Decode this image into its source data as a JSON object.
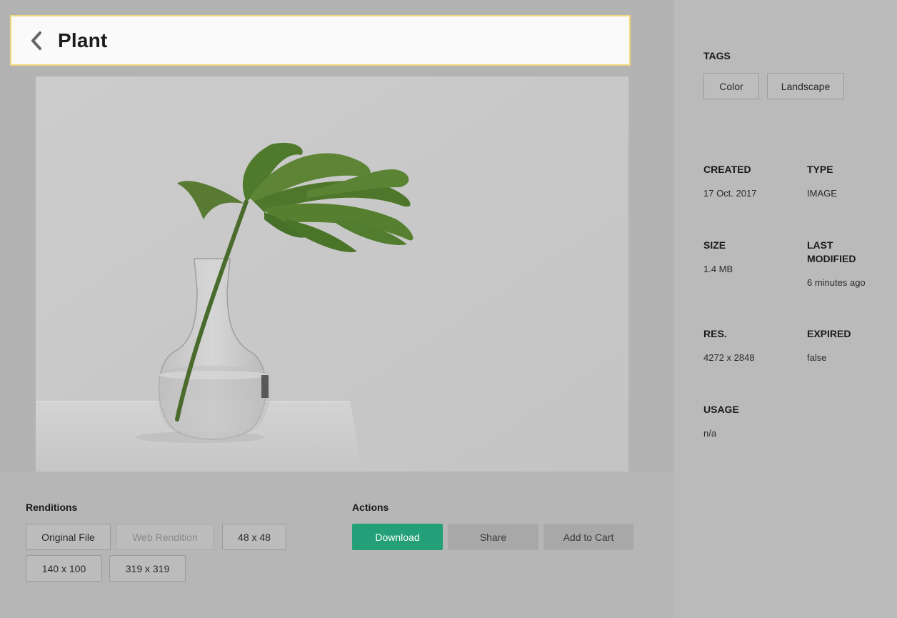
{
  "header": {
    "title": "Plant"
  },
  "icons": {
    "back": "chevron-left-icon",
    "preview": "plant-photo"
  },
  "colors": {
    "primary": "#23a077",
    "header_border": "#f1d77b"
  },
  "renditions": {
    "label": "Renditions",
    "items": [
      {
        "label": "Original File",
        "disabled": false
      },
      {
        "label": "Web Rendition",
        "disabled": true
      },
      {
        "label": "48 x 48",
        "disabled": false
      },
      {
        "label": "140 x 100",
        "disabled": false
      },
      {
        "label": "319 x 319",
        "disabled": false
      }
    ]
  },
  "actions": {
    "label": "Actions",
    "download": "Download",
    "share": "Share",
    "add_to_cart": "Add to Cart"
  },
  "tags": {
    "label": "TAGS",
    "items": [
      "Color",
      "Landscape"
    ]
  },
  "meta": {
    "created": {
      "label": "CREATED",
      "value": "17 Oct. 2017"
    },
    "type": {
      "label": "TYPE",
      "value": "IMAGE"
    },
    "size": {
      "label": "SIZE",
      "value": "1.4 MB"
    },
    "last_modified": {
      "label": "LAST MODIFIED",
      "value": "6 minutes ago"
    },
    "res": {
      "label": "RES.",
      "value": "4272 x 2848"
    },
    "expired": {
      "label": "EXPIRED",
      "value": "false"
    },
    "usage": {
      "label": "USAGE",
      "value": "n/a"
    }
  }
}
